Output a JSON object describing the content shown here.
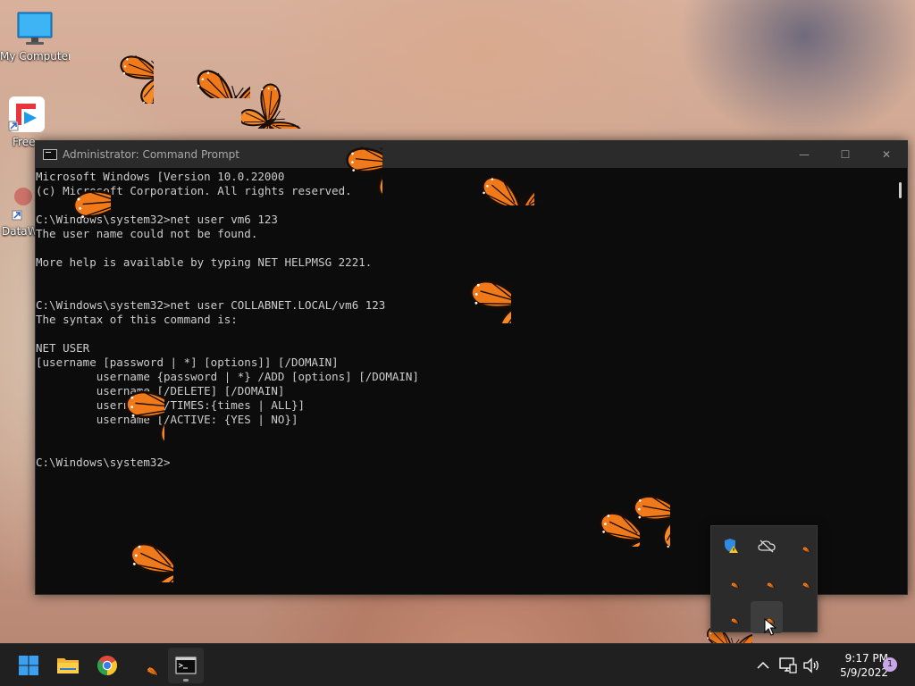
{
  "desktop": {
    "icons": [
      {
        "label": "My Computer",
        "icon": "monitor-icon"
      },
      {
        "label": "Free",
        "icon": "free-app-icon"
      },
      {
        "label": "DataW",
        "icon": "dataw-app-icon"
      }
    ]
  },
  "cmd": {
    "title": "Administrator: Command Prompt",
    "minimize": "—",
    "maximize": "☐",
    "close": "✕",
    "lines": [
      "Microsoft Windows [Version 10.0.22000",
      "(c) Microsoft Corporation. All rights reserved.",
      "",
      "C:\\Windows\\system32>net user vm6 123",
      "The user name could not be found.",
      "",
      "More help is available by typing NET HELPMSG 2221.",
      "",
      "",
      "C:\\Windows\\system32>net user COLLABNET.LOCAL/vm6 123",
      "The syntax of this command is:",
      "",
      "NET USER",
      "[username [password | *] [options]] [/DOMAIN]",
      "         username {password | *} /ADD [options] [/DOMAIN]",
      "         username [/DELETE] [/DOMAIN]",
      "         username [/TIMES:{times | ALL}]",
      "         username [/ACTIVE: {YES | NO}]",
      "",
      "",
      "C:\\Windows\\system32>"
    ]
  },
  "taskbar": {
    "apps": [
      {
        "name": "start-button",
        "icon": "windows-logo-icon"
      },
      {
        "name": "file-explorer-button",
        "icon": "folder-icon"
      },
      {
        "name": "chrome-button",
        "icon": "chrome-icon"
      },
      {
        "name": "butterfly-app-button",
        "icon": "butterfly-icon"
      },
      {
        "name": "command-prompt-button",
        "icon": "terminal-icon"
      }
    ],
    "tray": {
      "chevron": "^",
      "time": "9:17 PM",
      "date": "5/9/2022",
      "notifications": "1"
    }
  },
  "tray_flyout": {
    "items": [
      {
        "icon": "security-warning-icon"
      },
      {
        "icon": "cloud-offline-icon"
      },
      {
        "icon": "butterfly-icon"
      },
      {
        "icon": "butterfly-icon"
      },
      {
        "icon": "butterfly-icon"
      },
      {
        "icon": "butterfly-icon"
      },
      {
        "icon": "butterfly-icon"
      },
      {
        "icon": "butterfly-icon"
      }
    ]
  },
  "colors": {
    "butterfly_orange": "#f07a1a",
    "taskbar": "#202020",
    "terminal_bg": "#0c0c0c",
    "terminal_text": "#cccccc"
  }
}
